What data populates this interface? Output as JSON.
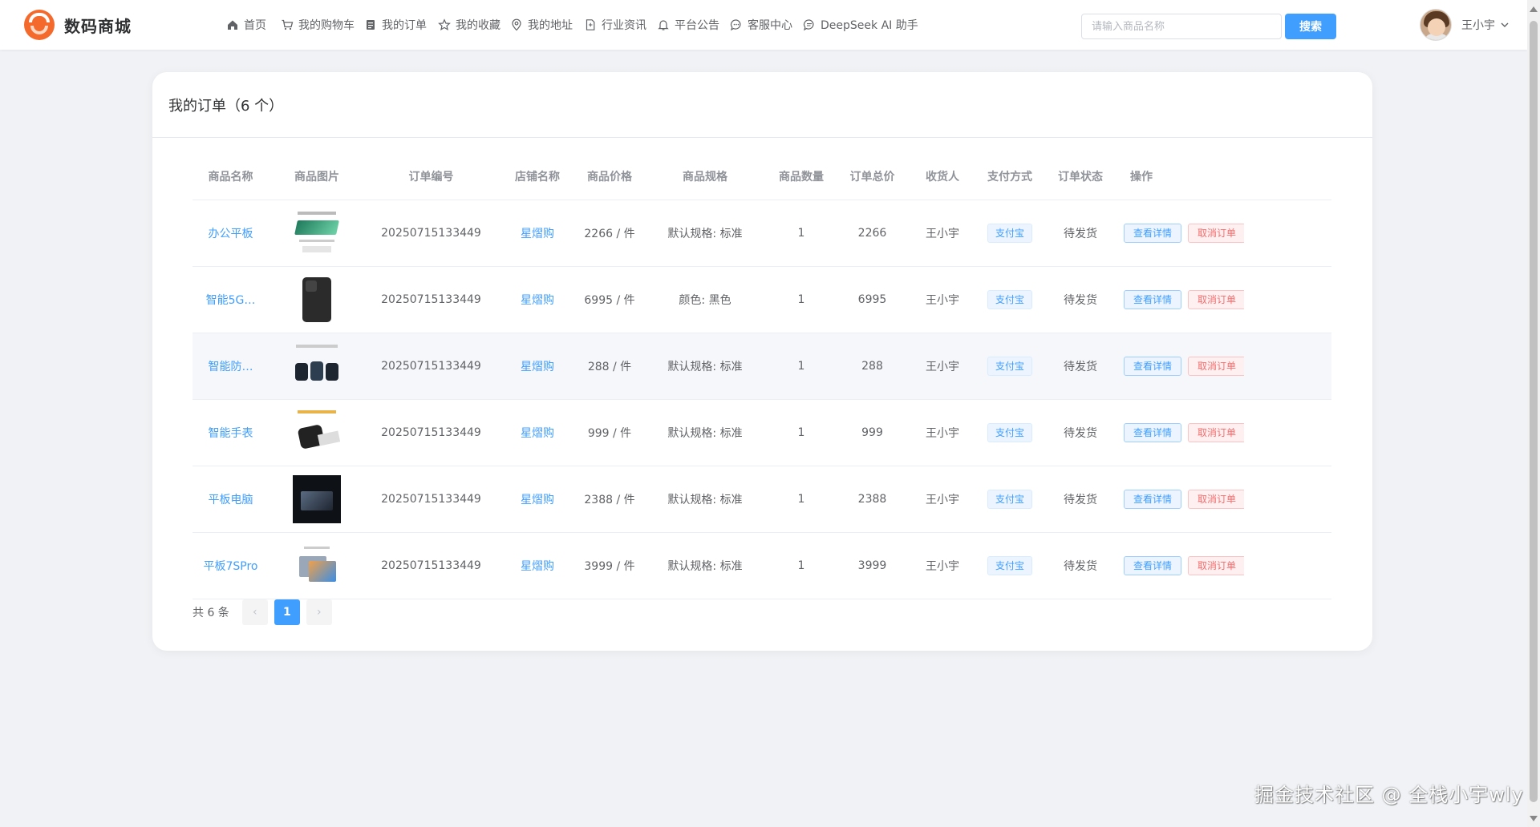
{
  "app": {
    "name": "数码商城"
  },
  "nav": [
    {
      "label": "首页",
      "icon": "home-icon"
    },
    {
      "label": "我的购物车",
      "icon": "cart-icon"
    },
    {
      "label": "我的订单",
      "icon": "order-icon"
    },
    {
      "label": "我的收藏",
      "icon": "star-icon"
    },
    {
      "label": "我的地址",
      "icon": "location-icon"
    },
    {
      "label": "行业资讯",
      "icon": "document-icon"
    },
    {
      "label": "平台公告",
      "icon": "bell-icon"
    },
    {
      "label": "客服中心",
      "icon": "chat-icon"
    },
    {
      "label": "DeepSeek AI 助手",
      "icon": "ai-chat-icon"
    }
  ],
  "search": {
    "placeholder": "请输入商品名称",
    "button": "搜索"
  },
  "user": {
    "name": "王小宇"
  },
  "orders": {
    "title": "我的订单（6 个）",
    "columns": [
      "商品名称",
      "商品图片",
      "订单编号",
      "店铺名称",
      "商品价格",
      "商品规格",
      "商品数量",
      "订单总价",
      "收货人",
      "支付方式",
      "订单状态",
      "操作"
    ],
    "rows": [
      {
        "name": "办公平板",
        "order_no": "20250715133449",
        "shop": "星熠购",
        "price": "2266 / 件",
        "spec": "默认规格: 标准",
        "qty": "1",
        "total": "2266",
        "receiver": "王小宇",
        "pay": "支付宝",
        "status": "待发货",
        "thumb": "tablet-green"
      },
      {
        "name": "智能5G…",
        "order_no": "20250715133449",
        "shop": "星熠购",
        "price": "6995 / 件",
        "spec": "颜色: 黑色",
        "qty": "1",
        "total": "6995",
        "receiver": "王小宇",
        "pay": "支付宝",
        "status": "待发货",
        "thumb": "phone-black"
      },
      {
        "name": "智能防…",
        "order_no": "20250715133449",
        "shop": "星熠购",
        "price": "288 / 件",
        "spec": "默认规格: 标准",
        "qty": "1",
        "total": "288",
        "receiver": "王小宇",
        "pay": "支付宝",
        "status": "待发货",
        "thumb": "watches"
      },
      {
        "name": "智能手表",
        "order_no": "20250715133449",
        "shop": "星熠购",
        "price": "999 / 件",
        "spec": "默认规格: 标准",
        "qty": "1",
        "total": "999",
        "receiver": "王小宇",
        "pay": "支付宝",
        "status": "待发货",
        "thumb": "smartwatch"
      },
      {
        "name": "平板电脑",
        "order_no": "20250715133449",
        "shop": "星熠购",
        "price": "2388 / 件",
        "spec": "默认规格: 标准",
        "qty": "1",
        "total": "2388",
        "receiver": "王小宇",
        "pay": "支付宝",
        "status": "待发货",
        "thumb": "tablet-dark"
      },
      {
        "name": "平板7SPro",
        "order_no": "20250715133449",
        "shop": "星熠购",
        "price": "3999 / 件",
        "spec": "默认规格: 标准",
        "qty": "1",
        "total": "3999",
        "receiver": "王小宇",
        "pay": "支付宝",
        "status": "待发货",
        "thumb": "tablet-color"
      }
    ],
    "actions": {
      "view": "查看详情",
      "cancel": "取消订单"
    }
  },
  "pagination": {
    "total_text": "共 6 条",
    "current": "1",
    "prev": "‹",
    "next": "›"
  },
  "watermark": "掘金技术社区 @ 全栈小宇wly",
  "colors": {
    "primary": "#409eff",
    "danger": "#f56c6c",
    "brand": "#f46a2c",
    "background": "#f0f2f5"
  }
}
